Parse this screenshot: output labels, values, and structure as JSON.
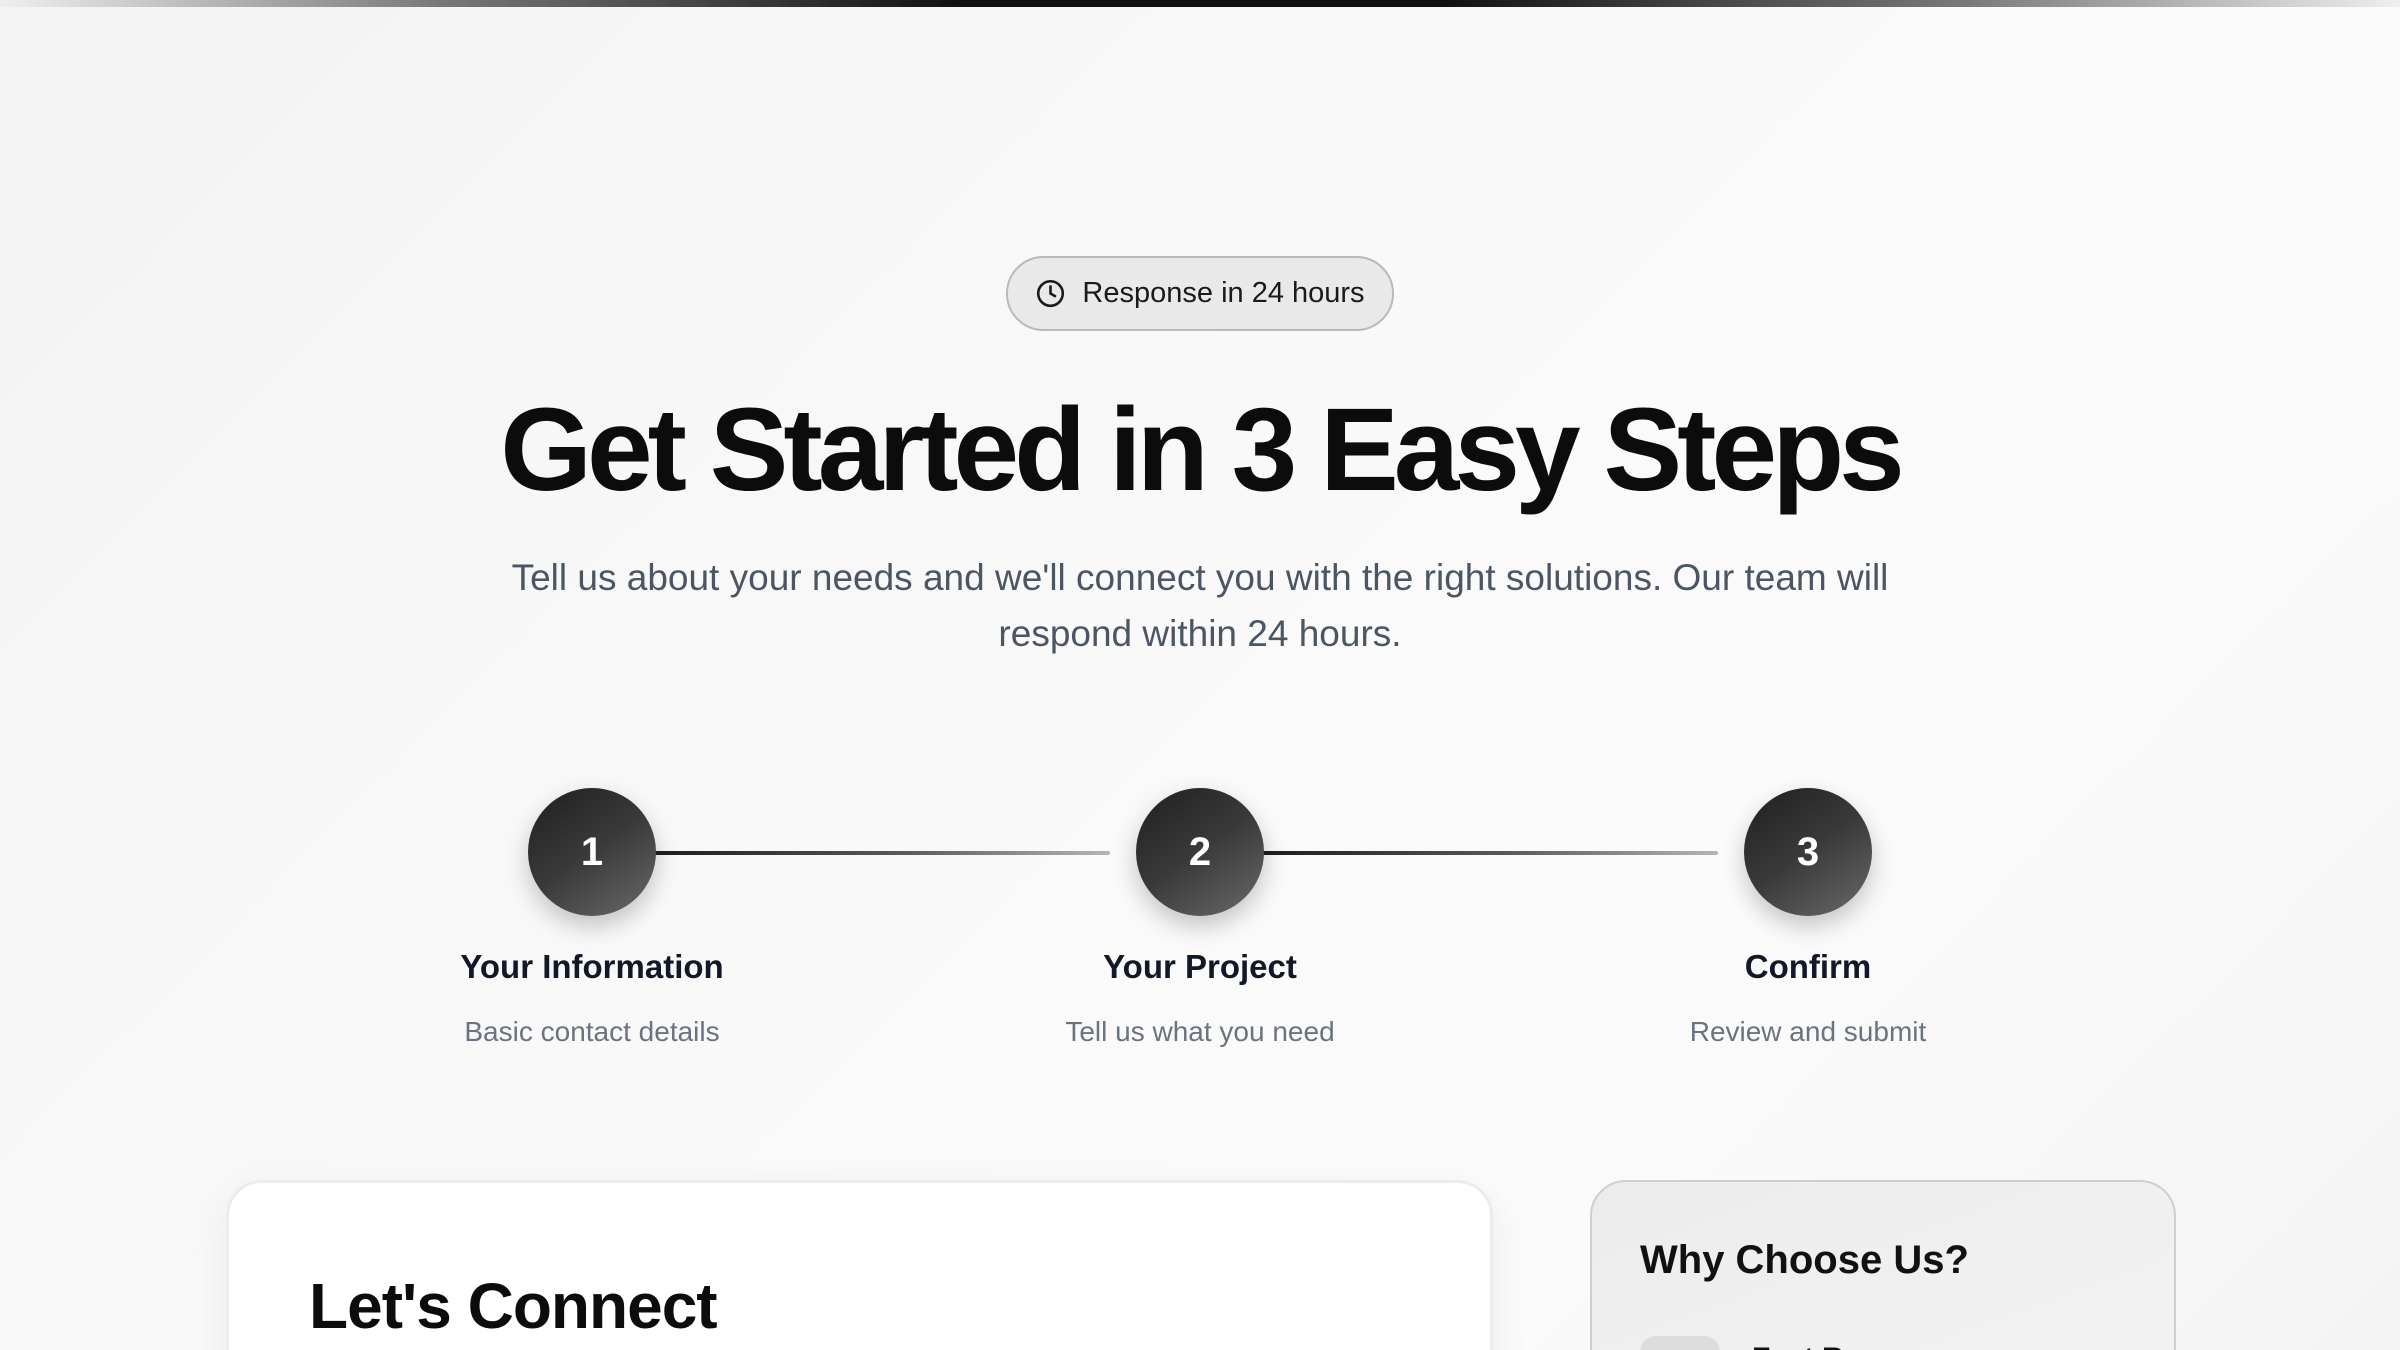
{
  "badge": {
    "icon": "clock-icon",
    "text": "Response in 24 hours"
  },
  "hero": {
    "title": "Get Started in 3 Easy Steps",
    "subtitle": "Tell us about your needs and we'll connect you with the right solutions. Our team will respond within 24 hours."
  },
  "steps": [
    {
      "number": "1",
      "title": "Your Information",
      "description": "Basic contact details"
    },
    {
      "number": "2",
      "title": "Your Project",
      "description": "Tell us what you need"
    },
    {
      "number": "3",
      "title": "Confirm",
      "description": "Review and submit"
    }
  ],
  "form": {
    "title": "Let's Connect"
  },
  "sidebar": {
    "title": "Why Choose Us?",
    "first_item": {
      "icon": "feature-icon",
      "label": "Fast Response"
    }
  },
  "colors": {
    "accent": "#111111",
    "muted_text": "#6b7280",
    "body_text": "#4b5563"
  }
}
